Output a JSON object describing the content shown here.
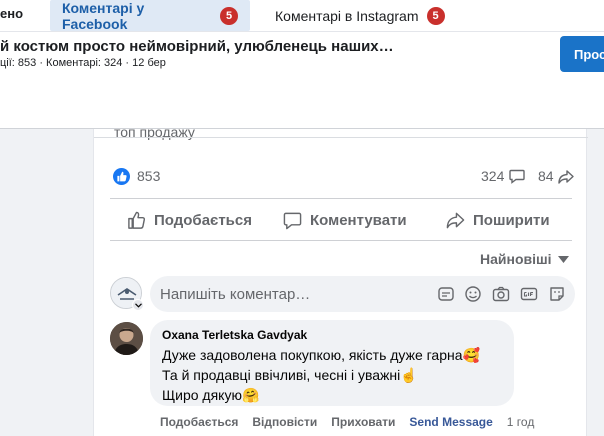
{
  "tabs": {
    "partial_label": "ено",
    "facebook": {
      "label": "Коментарі у Facebook",
      "badge": "5"
    },
    "instagram": {
      "label": "Коментарі в Instagram",
      "badge": "5"
    }
  },
  "post": {
    "title": "й костюм просто неймовірний, улюбленець наших…",
    "meta": "ції: 853 · Коментарі: 324 · 12 бер",
    "promo_button": "Прос"
  },
  "card": {
    "cut_text": "топ продажу",
    "likes": "853",
    "comments": "324",
    "shares": "84",
    "actions": {
      "like": "Подобається",
      "comment": "Коментувати",
      "share": "Поширити"
    },
    "sort_label": "Найновіші",
    "composer_placeholder": "Напишіть коментар…",
    "comment": {
      "author": "Oxana Terletska Gavdyak",
      "lines": [
        "Дуже задоволена покупкою, якість дуже гарна🥰",
        "Та й продавці ввічливі, чесні і уважні☝️",
        "Щиро дякую🤗"
      ],
      "actions": {
        "like": "Подобається",
        "reply": "Відповісти",
        "hide": "Приховати",
        "send": "Send Message",
        "time": "1 год"
      }
    }
  },
  "colors": {
    "accent_blue": "#1877f2",
    "tab_active_bg": "#dfe9f5",
    "badge_red": "#c9302c",
    "send_message": "#385898"
  },
  "icons": {
    "like_reaction": "thumbs-up-icon",
    "comment": "speech-bubble-icon",
    "share": "share-arrow-icon",
    "sort": "triangle-down-icon",
    "composer": [
      "sticker-icon",
      "emoji-icon",
      "camera-icon",
      "gif-icon",
      "avatar-sticker-icon"
    ]
  }
}
